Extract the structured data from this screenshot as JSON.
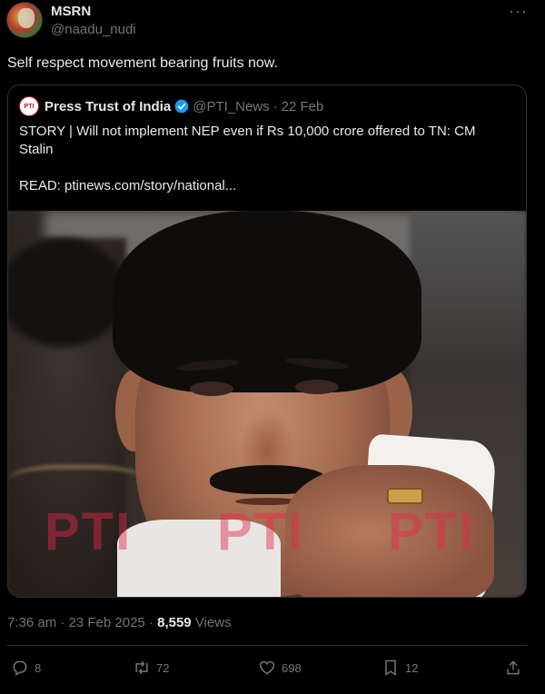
{
  "author": {
    "display_name": "MSRN",
    "handle": "@naadu_nudi",
    "more_icon": "more-icon"
  },
  "tweet": {
    "text": "Self respect movement bearing fruits now."
  },
  "quote": {
    "logo_text": "PTI",
    "name": "Press Trust of India",
    "verified_color": "#1d9bf0",
    "handle": "@PTI_News",
    "separator": "·",
    "date": "22 Feb",
    "body": "STORY | Will not implement NEP even if Rs 10,000 crore offered to TN: CM Stalin",
    "read_link": "READ: ptinews.com/story/national..."
  },
  "photo": {
    "watermark": [
      "PTI",
      "PTI",
      "PTI"
    ]
  },
  "meta": {
    "timestamp": "7:36 am · 23 Feb 2025 · ",
    "views_count": "8,559",
    "views_label": " Views"
  },
  "actions": {
    "reply_count": "8",
    "retweet_count": "72",
    "like_count": "698",
    "bookmark_count": "12"
  },
  "colors": {
    "background": "#000000",
    "text_primary": "#e7e9ea",
    "text_secondary": "#71767b",
    "border": "#2f3336"
  }
}
